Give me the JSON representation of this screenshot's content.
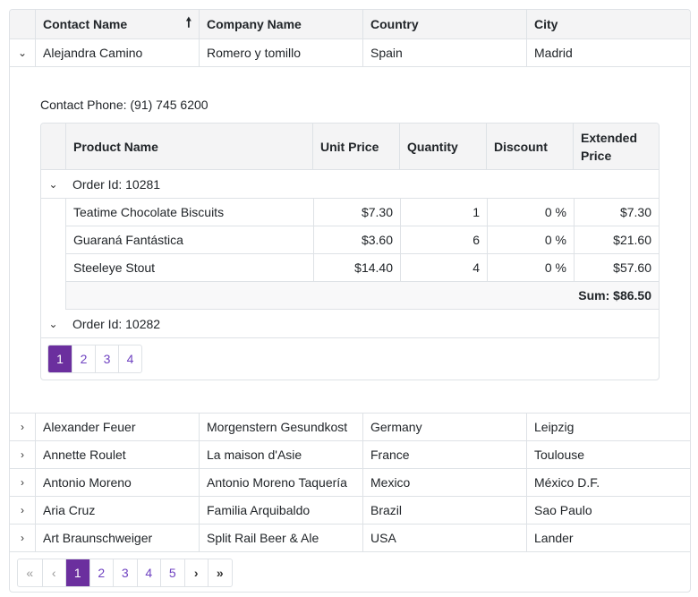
{
  "grid": {
    "columns": [
      "Contact Name",
      "Company Name",
      "Country",
      "City"
    ],
    "sort_icon": "sort-ascending-icon",
    "expanded_row": {
      "contact": "Alejandra Camino",
      "company": "Romero y tomillo",
      "country": "Spain",
      "city": "Madrid",
      "detail": {
        "phone_label": "Contact Phone: (91) 745 6200",
        "columns": [
          "Product Name",
          "Unit Price",
          "Quantity",
          "Discount",
          "Extended Price"
        ],
        "groups": [
          {
            "label": "Order Id: 10281",
            "expanded": true,
            "rows": [
              {
                "product": "Teatime Chocolate Biscuits",
                "unit_price": "$7.30",
                "quantity": "1",
                "discount": "0 %",
                "extended": "$7.30"
              },
              {
                "product": "Guaraná Fantástica",
                "unit_price": "$3.60",
                "quantity": "6",
                "discount": "0 %",
                "extended": "$21.60"
              },
              {
                "product": "Steeleye Stout",
                "unit_price": "$14.40",
                "quantity": "4",
                "discount": "0 %",
                "extended": "$57.60"
              }
            ],
            "summary": "Sum: $86.50"
          },
          {
            "label": "Order Id: 10282",
            "expanded": true
          }
        ],
        "pager": {
          "pages": [
            "1",
            "2",
            "3",
            "4"
          ],
          "current": "1"
        }
      }
    },
    "rows": [
      {
        "contact": "Alexander Feuer",
        "company": "Morgenstern Gesundkost",
        "country": "Germany",
        "city": "Leipzig"
      },
      {
        "contact": "Annette Roulet",
        "company": "La maison d'Asie",
        "country": "France",
        "city": "Toulouse"
      },
      {
        "contact": "Antonio Moreno",
        "company": "Antonio Moreno Taquería",
        "country": "Mexico",
        "city": "México D.F."
      },
      {
        "contact": "Aria Cruz",
        "company": "Familia Arquibaldo",
        "country": "Brazil",
        "city": "Sao Paulo"
      },
      {
        "contact": "Art Braunschweiger",
        "company": "Split Rail Beer & Ale",
        "country": "USA",
        "city": "Lander"
      }
    ],
    "pager": {
      "first": "«",
      "prev": "‹",
      "pages": [
        "1",
        "2",
        "3",
        "4",
        "5"
      ],
      "current": "1",
      "next": "›",
      "last": "»"
    },
    "colors": {
      "accent": "#6b2f9e",
      "link": "#6f42c1",
      "border": "#dee2e6",
      "header_bg": "#f4f4f5"
    }
  }
}
